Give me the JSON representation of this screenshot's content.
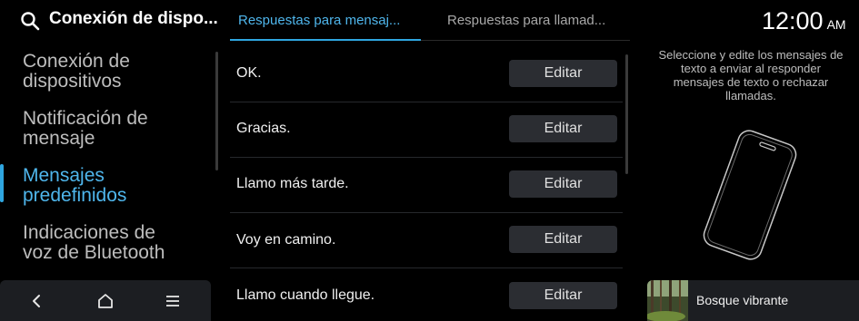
{
  "header": {
    "title": "Conexión de dispo..."
  },
  "sidebar": {
    "items": [
      {
        "label_line1": "Conexión de",
        "label_line2": "dispositivos"
      },
      {
        "label_line1": "Notificación de",
        "label_line2": "mensaje"
      },
      {
        "label_line1": "Mensajes",
        "label_line2": "predefinidos"
      },
      {
        "label_line1": "Indicaciones de",
        "label_line2": "voz de Bluetooth"
      }
    ],
    "active_index": 2
  },
  "tabs": [
    {
      "label": "Respuestas para mensaj..."
    },
    {
      "label": "Respuestas para llamad..."
    }
  ],
  "messages": [
    {
      "text": "OK.",
      "button": "Editar"
    },
    {
      "text": "Gracias.",
      "button": "Editar"
    },
    {
      "text": "Llamo más tarde.",
      "button": "Editar"
    },
    {
      "text": "Voy en camino.",
      "button": "Editar"
    },
    {
      "text": "Llamo cuando llegue.",
      "button": "Editar"
    }
  ],
  "status": {
    "time": "12:00",
    "ampm": "AM"
  },
  "instructions": "Seleccione y edite los mensajes de texto a enviar al responder mensajes de texto o rechazar llamadas.",
  "media": {
    "title": "Bosque vibrante"
  },
  "colors": {
    "accent": "#4fb6ec",
    "background": "#000000",
    "button": "#2b2d32"
  },
  "icons": [
    "search-icon",
    "back-icon",
    "home-icon",
    "menu-icon",
    "phone-illustration"
  ]
}
